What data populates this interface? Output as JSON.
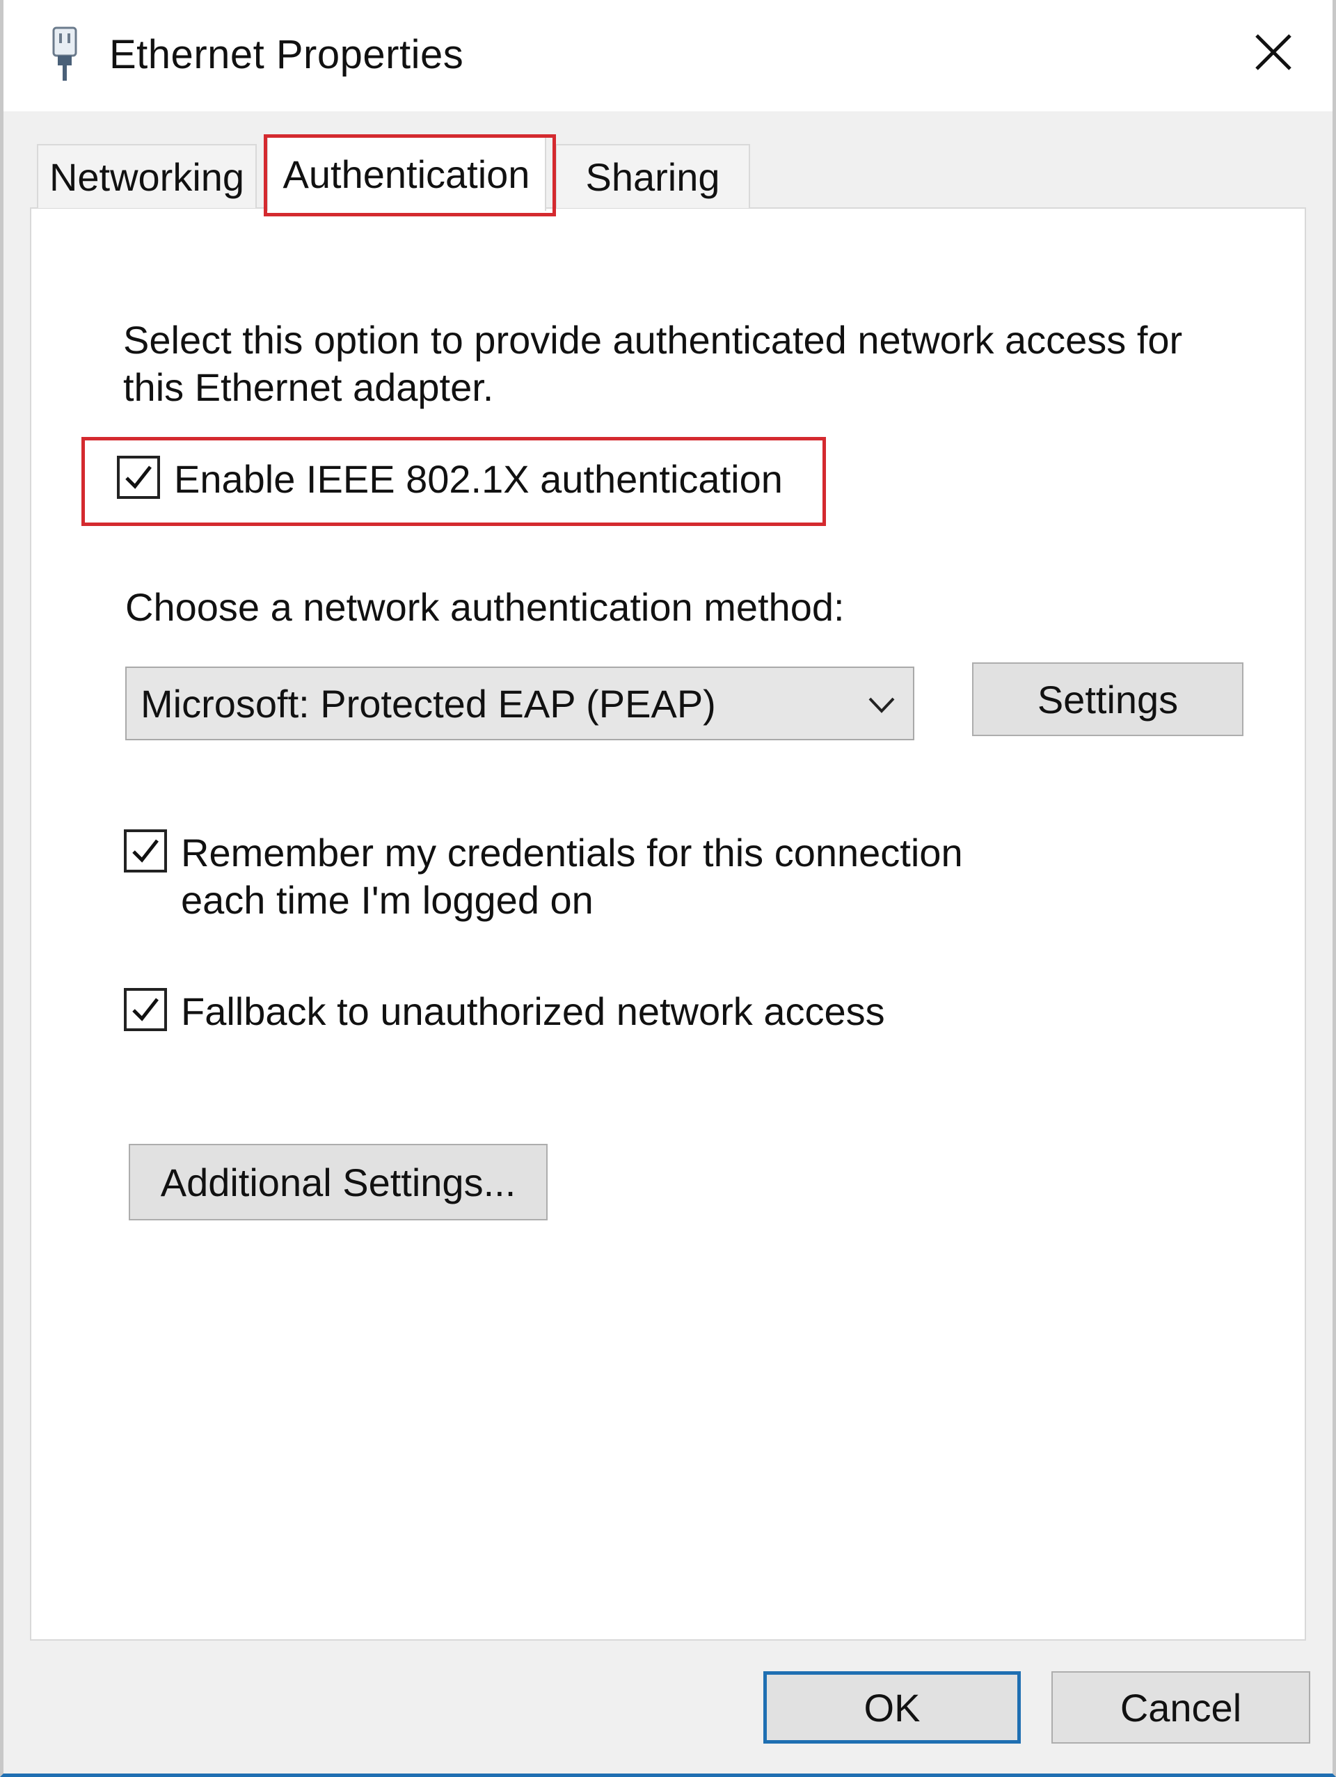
{
  "window": {
    "title": "Ethernet Properties",
    "title_icon": "network-adapter-icon",
    "close_icon": "close-icon"
  },
  "tabs": [
    {
      "label": "Networking",
      "selected": false
    },
    {
      "label": "Authentication",
      "selected": true
    },
    {
      "label": "Sharing",
      "selected": false
    }
  ],
  "panel": {
    "description": "Select this option to provide authenticated network access for this Ethernet adapter.",
    "enable_8021x": {
      "label": "Enable IEEE 802.1X authentication",
      "checked": true
    },
    "method_label": "Choose a network authentication method:",
    "method_dropdown": {
      "value": "Microsoft: Protected EAP (PEAP)"
    },
    "settings_button": "Settings",
    "remember_credentials": {
      "label": "Remember my credentials for this connection each time I'm logged on",
      "checked": true
    },
    "fallback": {
      "label": "Fallback to unauthorized network access",
      "checked": true
    },
    "additional_settings_button": "Additional Settings..."
  },
  "footer": {
    "ok_label": "OK",
    "cancel_label": "Cancel"
  },
  "colors": {
    "highlight": "#d42a2f",
    "focus_border": "#1f6fb2"
  }
}
